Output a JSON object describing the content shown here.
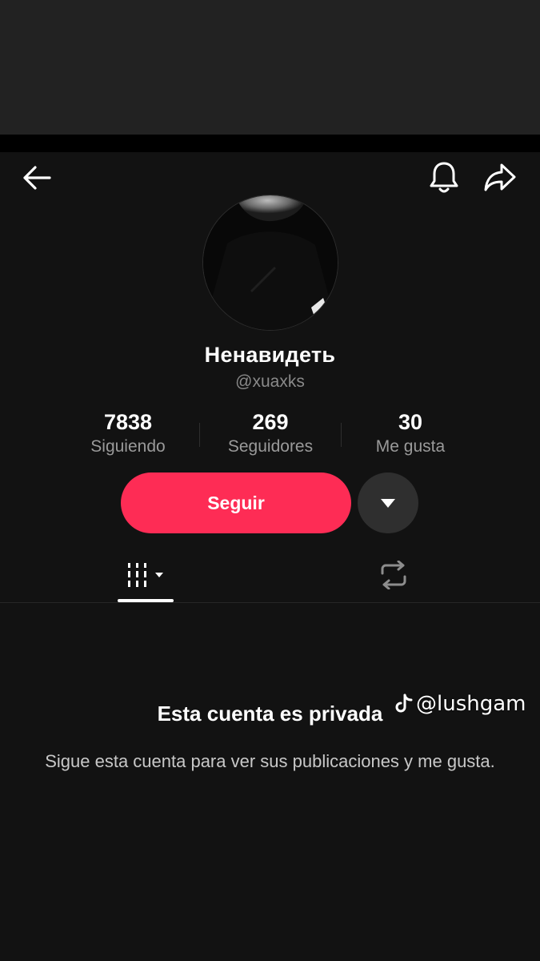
{
  "profile": {
    "display_name": "Ненавидеть",
    "username": "@xuaxks",
    "avatar_icon": "profile-photo"
  },
  "stats": {
    "following": {
      "value": "7838",
      "label": "Siguiendo"
    },
    "followers": {
      "value": "269",
      "label": "Seguidores"
    },
    "likes": {
      "value": "30",
      "label": "Me gusta"
    }
  },
  "actions": {
    "follow_label": "Seguir",
    "dropdown_icon": "caret-down-icon"
  },
  "header": {
    "back_icon": "arrow-left-icon",
    "bell_icon": "bell-icon",
    "share_icon": "share-icon"
  },
  "tabs": [
    {
      "icon": "grid-icon",
      "active": true
    },
    {
      "icon": "repost-icon",
      "active": false
    }
  ],
  "private": {
    "title": "Esta cuenta es privada",
    "description": "Sigue esta cuenta para ver sus publicaciones y me gusta."
  },
  "watermark": {
    "text": "@lushgam",
    "icon": "tiktok-logo-icon"
  },
  "colors": {
    "accent": "#fe2c55",
    "background": "#121212",
    "secondary_text": "#8a8a8a"
  }
}
